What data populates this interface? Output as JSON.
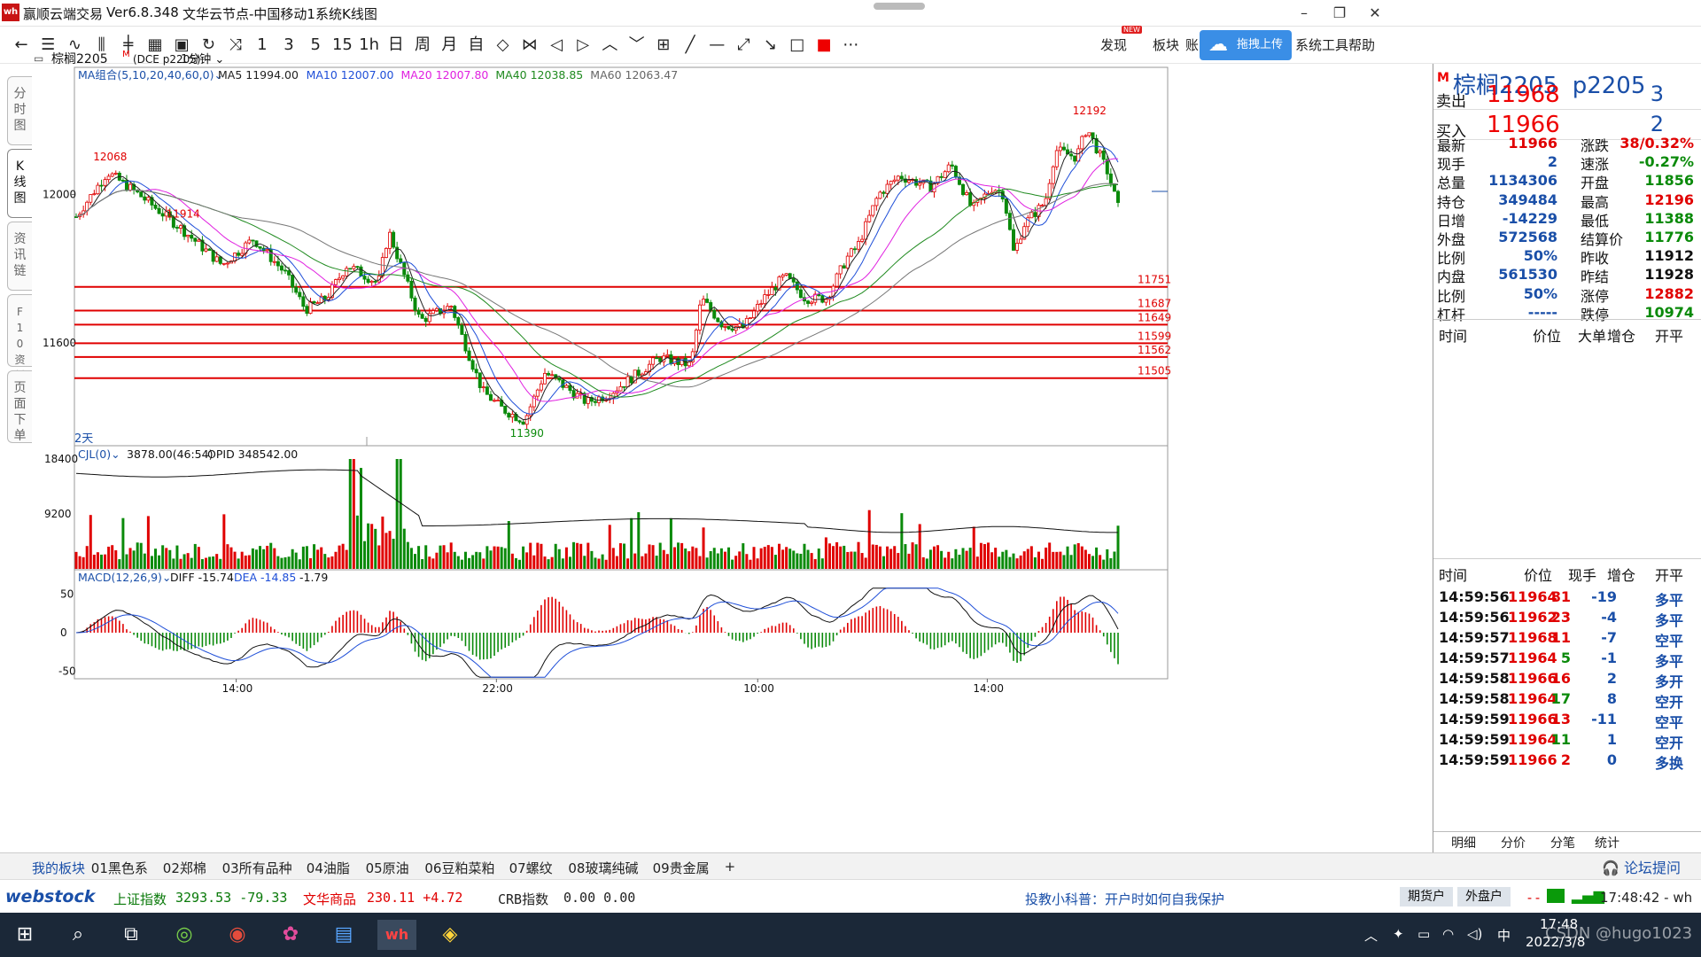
{
  "window": {
    "app_title": "赢顺云端交易",
    "version": "Ver6.8.348",
    "node": "文华云节点-中国移动1",
    "view": "系统K线图",
    "logo": "wh"
  },
  "toolbar": {
    "items": [
      "←",
      "☰",
      "∿",
      "⫼",
      "╪",
      "▦",
      "▣",
      "↻",
      "⤨",
      "1",
      "3",
      "5",
      "15",
      "1h",
      "日",
      "周",
      "月",
      "自",
      "◇",
      "⋈",
      "◁",
      "▷",
      "︿",
      "﹀",
      "⊞",
      "╱",
      "—",
      "⤢",
      "↘",
      "□",
      "■",
      "⋯"
    ],
    "right": {
      "discover": "发现",
      "new_badge": "NEW",
      "board": "板块",
      "account": "账",
      "upload": "拖拽上传",
      "tools": "系统工具",
      "help": "帮助"
    }
  },
  "leftnav": [
    {
      "label": "分\n时\n图"
    },
    {
      "label": "K\n线\n图"
    },
    {
      "label": "资\n讯\n链"
    },
    {
      "label": "F\n1\n0\n资\n料"
    },
    {
      "label": "页\n面\n下\n单"
    }
  ],
  "symbol_bar": {
    "name": "棕榈2205",
    "mark": "M",
    "code": "(DCE p2205)",
    "period": "1分钟"
  },
  "ma_bar": {
    "group": "MA组合(5,10,20,40,60,0)",
    "items": [
      {
        "label": "MA5 11994.00",
        "color": "#222222"
      },
      {
        "label": "MA10 12007.00",
        "color": "#1f4fd8"
      },
      {
        "label": "MA20 12007.80",
        "color": "#e020e0"
      },
      {
        "label": "MA40 12038.85",
        "color": "#1f8a1f"
      },
      {
        "label": "MA60 12063.47",
        "color": "#666666"
      }
    ]
  },
  "chart_data": [
    {
      "type": "candlestick",
      "symbol": "棕榈2205",
      "ylim": [
        11330,
        12290
      ],
      "yticks": [
        12000,
        11600
      ],
      "xticks": [
        "14:00",
        "22:00",
        "10:00",
        "14:00"
      ],
      "day_marker": "2天",
      "annotations": [
        {
          "label": "12068",
          "value": 12068,
          "color": "#e00000"
        },
        {
          "label": "11914",
          "value": 11914,
          "color": "#e00000"
        },
        {
          "label": "11390",
          "value": 11390,
          "color": "#0a8a0a"
        },
        {
          "label": "12192",
          "value": 12192,
          "color": "#e00000"
        }
      ],
      "hlines": [
        11751,
        11687,
        11649,
        11599,
        11562,
        11505
      ],
      "price_path": [
        [
          0,
          11940
        ],
        [
          0.03,
          12060
        ],
        [
          0.06,
          12000
        ],
        [
          0.1,
          11910
        ],
        [
          0.14,
          11810
        ],
        [
          0.17,
          11880
        ],
        [
          0.2,
          11790
        ],
        [
          0.22,
          11690
        ],
        [
          0.24,
          11720
        ],
        [
          0.26,
          11810
        ],
        [
          0.29,
          11760
        ],
        [
          0.3,
          11900
        ],
        [
          0.31,
          11820
        ],
        [
          0.33,
          11660
        ],
        [
          0.36,
          11700
        ],
        [
          0.37,
          11620
        ],
        [
          0.39,
          11470
        ],
        [
          0.41,
          11420
        ],
        [
          0.43,
          11390
        ],
        [
          0.45,
          11520
        ],
        [
          0.47,
          11480
        ],
        [
          0.49,
          11440
        ],
        [
          0.51,
          11460
        ],
        [
          0.54,
          11520
        ],
        [
          0.56,
          11560
        ],
        [
          0.59,
          11540
        ],
        [
          0.6,
          11720
        ],
        [
          0.62,
          11650
        ],
        [
          0.64,
          11640
        ],
        [
          0.66,
          11720
        ],
        [
          0.68,
          11780
        ],
        [
          0.7,
          11720
        ],
        [
          0.72,
          11720
        ],
        [
          0.74,
          11830
        ],
        [
          0.75,
          11860
        ],
        [
          0.77,
          12000
        ],
        [
          0.79,
          12050
        ],
        [
          0.82,
          12020
        ],
        [
          0.84,
          12080
        ],
        [
          0.86,
          11960
        ],
        [
          0.88,
          12020
        ],
        [
          0.89,
          12000
        ],
        [
          0.9,
          11840
        ],
        [
          0.91,
          11920
        ],
        [
          0.93,
          11980
        ],
        [
          0.94,
          12120
        ],
        [
          0.96,
          12100
        ],
        [
          0.97,
          12180
        ],
        [
          0.99,
          12060
        ],
        [
          1.0,
          11966
        ]
      ]
    },
    {
      "type": "bar",
      "name": "CJL(0)",
      "ylim": [
        0,
        18400
      ],
      "yticks": [
        18400,
        9200
      ],
      "label": "CJL(0)",
      "value_label": "3878.00(46:54)",
      "opid_label": "OPID 348542.00"
    },
    {
      "type": "line",
      "name": "MACD(12,26,9)",
      "ylim": [
        -60,
        60
      ],
      "yticks": [
        50,
        0,
        -50
      ],
      "label": "MACD(12,26,9)",
      "diff_label": "DIFF -15.74",
      "dea_label": "DEA -14.85",
      "macd_label": "-1.79"
    }
  ],
  "quote": {
    "title_name": "棕榈2205",
    "title_code": "p2205",
    "title_mark": "M",
    "sell": {
      "label": "卖出",
      "price": "11968",
      "vol": "3"
    },
    "buy": {
      "label": "买入",
      "price": "11966",
      "vol": "2"
    },
    "stats_left": [
      {
        "l": "最新",
        "v": "11966",
        "c": "#e00000"
      },
      {
        "l": "现手",
        "v": "2",
        "c": "#1a4fa8"
      },
      {
        "l": "总量",
        "v": "1134306",
        "c": "#1a4fa8"
      },
      {
        "l": "持仓",
        "v": "349484",
        "c": "#1a4fa8"
      },
      {
        "l": "日增",
        "v": "-14229",
        "c": "#1a4fa8"
      },
      {
        "l": "外盘",
        "v": "572568",
        "c": "#1a4fa8"
      },
      {
        "l": "比例",
        "v": "50%",
        "c": "#1a4fa8"
      },
      {
        "l": "内盘",
        "v": "561530",
        "c": "#1a4fa8"
      },
      {
        "l": "比例",
        "v": "50%",
        "c": "#1a4fa8"
      },
      {
        "l": "杠杆",
        "v": "-----",
        "c": "#1a4fa8"
      }
    ],
    "stats_right": [
      {
        "l": "涨跌",
        "v": "38/0.32%",
        "c": "#e00000"
      },
      {
        "l": "速涨",
        "v": "-0.27%",
        "c": "#0a8a0a"
      },
      {
        "l": "开盘",
        "v": "11856",
        "c": "#0a8a0a"
      },
      {
        "l": "最高",
        "v": "12196",
        "c": "#e00000"
      },
      {
        "l": "最低",
        "v": "11388",
        "c": "#0a8a0a"
      },
      {
        "l": "结算价",
        "v": "11776",
        "c": "#0a8a0a"
      },
      {
        "l": "昨收",
        "v": "11912",
        "c": "#111111"
      },
      {
        "l": "昨结",
        "v": "11928",
        "c": "#111111"
      },
      {
        "l": "涨停",
        "v": "12882",
        "c": "#e00000"
      },
      {
        "l": "跌停",
        "v": "10974",
        "c": "#0a8a0a"
      }
    ],
    "hdr1": {
      "time": "时间",
      "price": "价位",
      "big": "大单",
      "inc": "增仓",
      "open": "开平"
    },
    "hdr2": {
      "time": "时间",
      "price": "价位",
      "hand": "现手",
      "inc": "增仓",
      "open": "开平"
    },
    "ticks": [
      {
        "t": "14:59:56",
        "p": "11964",
        "h": "81",
        "i": "-19",
        "o": "多平",
        "pc": "#e00000",
        "hc": "#e00000",
        "oc": "#1a4fa8"
      },
      {
        "t": "14:59:56",
        "p": "11962",
        "h": "23",
        "i": "-4",
        "o": "多平",
        "pc": "#e00000",
        "hc": "#e00000",
        "oc": "#1a4fa8"
      },
      {
        "t": "14:59:57",
        "p": "11968",
        "h": "11",
        "i": "-7",
        "o": "空平",
        "pc": "#e00000",
        "hc": "#e00000",
        "oc": "#1a4fa8"
      },
      {
        "t": "14:59:57",
        "p": "11964",
        "h": "5",
        "i": "-1",
        "o": "多平",
        "pc": "#e00000",
        "hc": "#0a8a0a",
        "oc": "#1a4fa8"
      },
      {
        "t": "14:59:58",
        "p": "11966",
        "h": "16",
        "i": "2",
        "o": "多开",
        "pc": "#e00000",
        "hc": "#e00000",
        "oc": "#1a4fa8"
      },
      {
        "t": "14:59:58",
        "p": "11964",
        "h": "17",
        "i": "8",
        "o": "空开",
        "pc": "#e00000",
        "hc": "#0a8a0a",
        "oc": "#1a4fa8"
      },
      {
        "t": "14:59:59",
        "p": "11966",
        "h": "13",
        "i": "-11",
        "o": "空平",
        "pc": "#e00000",
        "hc": "#e00000",
        "oc": "#1a4fa8"
      },
      {
        "t": "14:59:59",
        "p": "11964",
        "h": "11",
        "i": "1",
        "o": "空开",
        "pc": "#e00000",
        "hc": "#0a8a0a",
        "oc": "#1a4fa8"
      },
      {
        "t": "14:59:59",
        "p": "11966",
        "h": "2",
        "i": "0",
        "o": "多换",
        "pc": "#e00000",
        "hc": "#e00000",
        "oc": "#1a4fa8"
      }
    ],
    "tabs": [
      "明细",
      "分价",
      "分笔",
      "统计"
    ]
  },
  "sectors": [
    "我的板块",
    "01黑色系",
    "02郑棉",
    "03所有品种",
    "04油脂",
    "05原油",
    "06豆粕菜粕",
    "07螺纹",
    "08玻璃纯碱",
    "09贵金属",
    "+"
  ],
  "status": {
    "brand": "webstock",
    "sh_label": "上证指数",
    "sh_val": "3293.53 -79.33",
    "wh_label": "文华商品",
    "wh_val": "230.11 +4.72",
    "crb_label": "CRB指数",
    "crb_val": "0.00 0.00",
    "tip": "投教小科普：开户时如何自我保护",
    "btn1": "期货户",
    "btn2": "外盘户",
    "dash": "--",
    "clock": "17:48:42 - wh",
    "forum": "论坛提问"
  },
  "taskbar": {
    "time": "17:48",
    "date": "2022/3/8",
    "ime": "中",
    "watermark": "CSDN @hugo1023"
  }
}
